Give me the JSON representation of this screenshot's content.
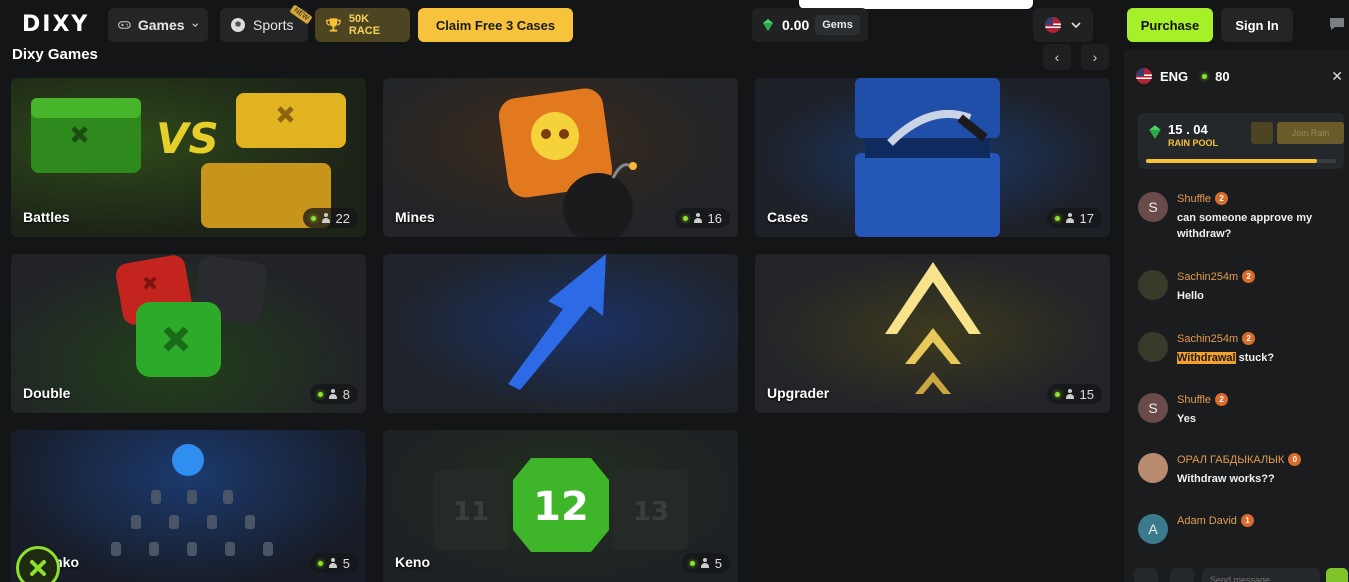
{
  "header": {
    "logo": "DIXY",
    "games_label": "Games",
    "sports_label": "Sports",
    "sports_tag": "NEW",
    "race_label": "50K RACE",
    "claim_label": "Claim Free 3 Cases",
    "gem_balance": "0.00",
    "gems_label": "Gems",
    "purchase_label": "Purchase",
    "signin_label": "Sign In"
  },
  "section": {
    "title": "Dixy Games",
    "prev": "‹",
    "next": "›"
  },
  "games": [
    {
      "label": "Battles",
      "count": "22"
    },
    {
      "label": "Mines",
      "count": "16"
    },
    {
      "label": "Cases",
      "count": "17"
    },
    {
      "label": "Double",
      "count": "8"
    },
    {
      "label": "",
      "count": ""
    },
    {
      "label": "Upgrader",
      "count": "15"
    },
    {
      "label": "Plinko",
      "count": "5"
    },
    {
      "label": "Keno",
      "count": "5"
    }
  ],
  "keno": {
    "numbers": [
      "11",
      "12",
      "13"
    ]
  },
  "chat": {
    "language": "ENG",
    "online": "80",
    "rain_value": "15 . 04",
    "rain_label": "RAIN POOL",
    "rain_join": "Join Rain",
    "rain_progress": 0.9,
    "send_placeholder": "Send message...",
    "messages": [
      {
        "name": "Shuffle",
        "level": "2",
        "initial": "S",
        "text": "can someone approve my withdraw?",
        "avatar_color": "#6b4a4a"
      },
      {
        "name": "Sachin254m",
        "level": "2",
        "initial": "",
        "text": "Hello",
        "avatar_color": "#3a3a2a"
      },
      {
        "name": "Sachin254m",
        "level": "2",
        "initial": "",
        "text_highlight": "Withdrawal",
        "text": " stuck?",
        "avatar_color": "#3a3a2a"
      },
      {
        "name": "Shuffle",
        "level": "2",
        "initial": "S",
        "text": "Yes",
        "avatar_color": "#6b4a4a"
      },
      {
        "name": "ОРАЛ ГАБДЫКАЛЫК",
        "level": "0",
        "initial": "",
        "text": "Withdraw works??",
        "avatar_color": "#b88a6e"
      },
      {
        "name": "Adam David",
        "level": "1",
        "initial": "A",
        "text": "",
        "avatar_color": "#3a7a8a"
      }
    ]
  }
}
